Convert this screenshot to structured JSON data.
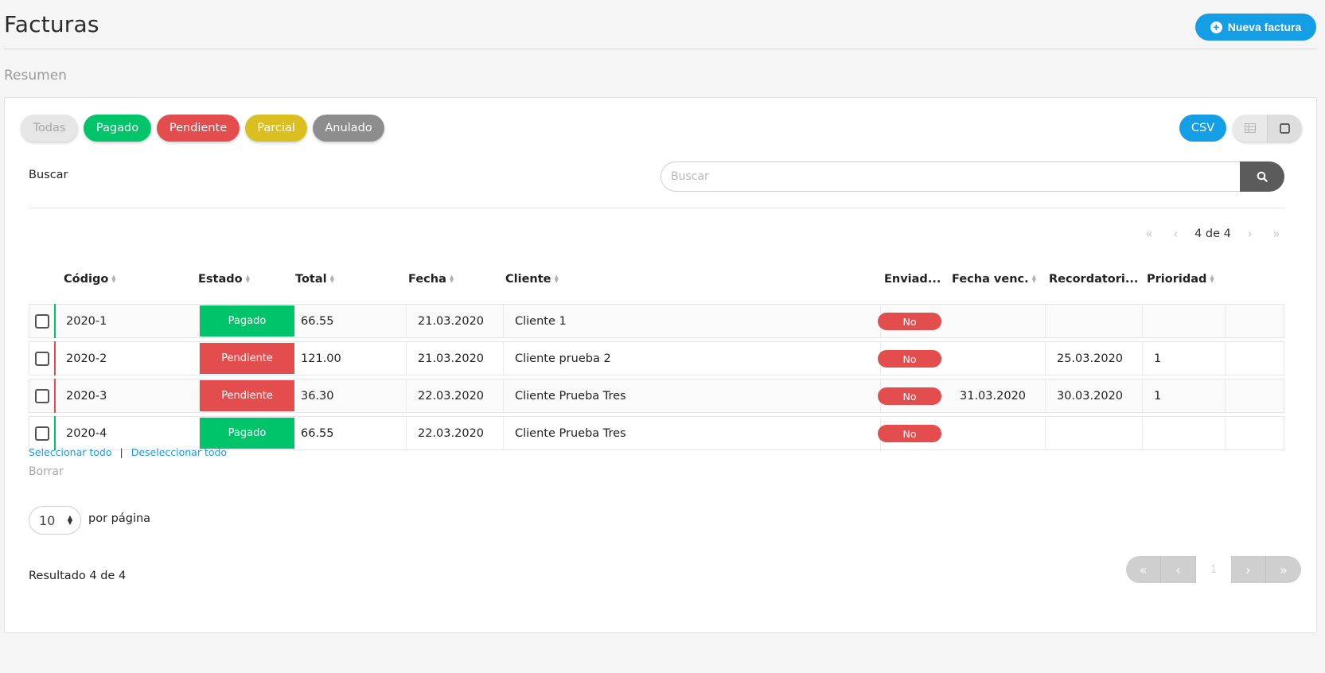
{
  "header": {
    "title": "Facturas",
    "new_button_label": "Nueva factura"
  },
  "section": {
    "title": "Resumen"
  },
  "filters": {
    "all": "Todas",
    "paid": "Pagado",
    "pending": "Pendiente",
    "partial": "Parcial",
    "void": "Anulado"
  },
  "toolbar": {
    "csv_label": "CSV"
  },
  "search": {
    "label": "Buscar",
    "placeholder": "Buscar",
    "value": ""
  },
  "pager_top": {
    "text": "4 de 4"
  },
  "columns": {
    "code": "Código",
    "status": "Estado",
    "total": "Total",
    "date": "Fecha",
    "client": "Cliente",
    "sent": "Enviad...",
    "due_date": "Fecha venc.",
    "reminder": "Recordatori...",
    "priority": "Prioridad"
  },
  "rows": [
    {
      "code": "2020-1",
      "status": "Pagado",
      "total": "66.55",
      "date": "21.03.2020",
      "client": "Cliente 1",
      "sent": "No",
      "due_date": "",
      "reminder": "",
      "priority": ""
    },
    {
      "code": "2020-2",
      "status": "Pendiente",
      "total": "121.00",
      "date": "21.03.2020",
      "client": "Cliente prueba 2",
      "sent": "No",
      "due_date": "",
      "reminder": "25.03.2020",
      "priority": "1"
    },
    {
      "code": "2020-3",
      "status": "Pendiente",
      "total": "36.30",
      "date": "22.03.2020",
      "client": "Cliente Prueba Tres",
      "sent": "No",
      "due_date": "31.03.2020",
      "reminder": "30.03.2020",
      "priority": "1"
    },
    {
      "code": "2020-4",
      "status": "Pagado",
      "total": "66.55",
      "date": "22.03.2020",
      "client": "Cliente Prueba Tres",
      "sent": "No",
      "due_date": "",
      "reminder": "",
      "priority": ""
    }
  ],
  "selection": {
    "select_all": "Seleccionar todo",
    "separator": "|",
    "deselect_all": "Deseleccionar todo",
    "delete": "Borrar"
  },
  "per_page": {
    "value": "10",
    "label": "por página"
  },
  "footer": {
    "result_text": "Resultado 4 de 4",
    "current_page": "1"
  },
  "colors": {
    "accent": "#139ee6",
    "paid": "#00c46a",
    "pending": "#e34d4d",
    "partial": "#dbbf20",
    "void": "#8d8d8d"
  }
}
